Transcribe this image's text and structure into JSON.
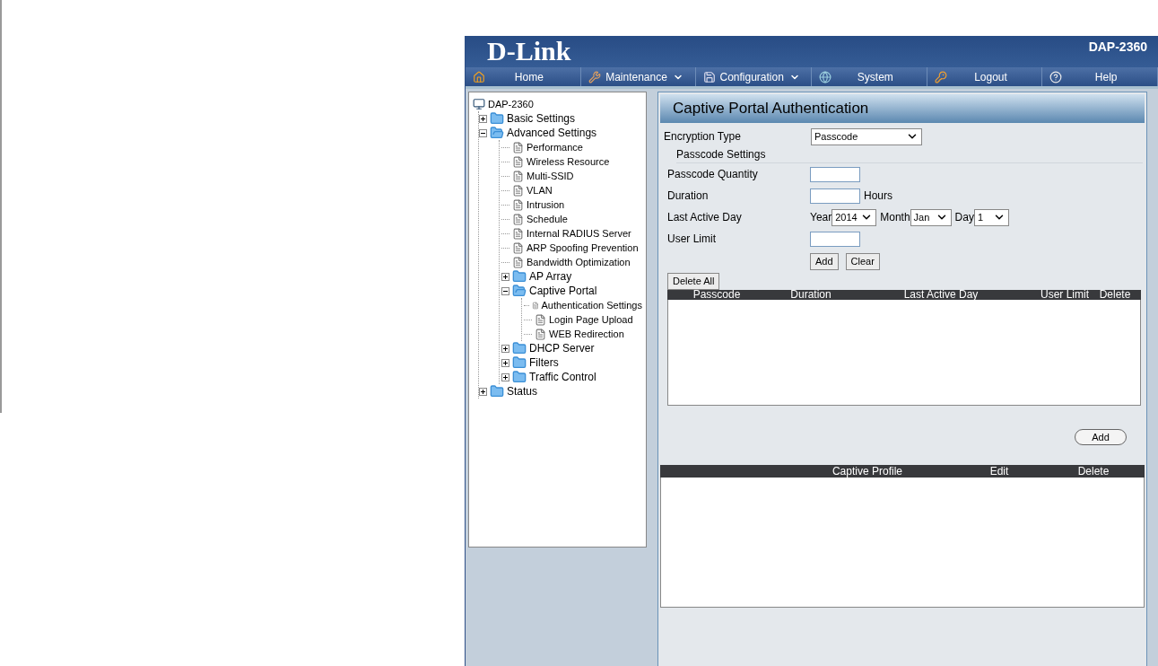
{
  "header": {
    "logo": "D-Link",
    "model": "DAP-2360"
  },
  "nav": [
    {
      "label": "Home",
      "has_menu": false
    },
    {
      "label": "Maintenance",
      "has_menu": true
    },
    {
      "label": "Configuration",
      "has_menu": true
    },
    {
      "label": "System",
      "has_menu": false
    },
    {
      "label": "Logout",
      "has_menu": false
    },
    {
      "label": "Help",
      "has_menu": false
    }
  ],
  "tree": {
    "label": "DAP-2360",
    "children": [
      {
        "label": "Basic Settings",
        "kind": "folder",
        "expanded": false
      },
      {
        "label": "Advanced Settings",
        "kind": "folder",
        "expanded": true,
        "children": [
          {
            "label": "Performance",
            "kind": "page"
          },
          {
            "label": "Wireless Resource",
            "kind": "page"
          },
          {
            "label": "Multi-SSID",
            "kind": "page"
          },
          {
            "label": "VLAN",
            "kind": "page"
          },
          {
            "label": "Intrusion",
            "kind": "page"
          },
          {
            "label": "Schedule",
            "kind": "page"
          },
          {
            "label": "Internal RADIUS Server",
            "kind": "page"
          },
          {
            "label": "ARP Spoofing Prevention",
            "kind": "page"
          },
          {
            "label": "Bandwidth Optimization",
            "kind": "page"
          },
          {
            "label": "AP Array",
            "kind": "folder",
            "expanded": false
          },
          {
            "label": "Captive Portal",
            "kind": "folder",
            "expanded": true,
            "children": [
              {
                "label": "Authentication Settings",
                "kind": "page"
              },
              {
                "label": "Login Page Upload",
                "kind": "page"
              },
              {
                "label": "WEB Redirection",
                "kind": "page"
              }
            ]
          },
          {
            "label": "DHCP Server",
            "kind": "folder",
            "expanded": false
          },
          {
            "label": "Filters",
            "kind": "folder",
            "expanded": false
          },
          {
            "label": "Traffic Control",
            "kind": "folder",
            "expanded": false
          }
        ]
      },
      {
        "label": "Status",
        "kind": "folder",
        "expanded": false
      }
    ]
  },
  "panel": {
    "title": "Captive Portal Authentication",
    "encryption_type": {
      "label": "Encryption Type",
      "value": "Passcode"
    },
    "section": "Passcode Settings",
    "passcode_quantity": {
      "label": "Passcode Quantity"
    },
    "duration": {
      "label": "Duration",
      "unit": "Hours"
    },
    "last_active_day": {
      "label": "Last Active Day",
      "year_label": "Year",
      "year": "2014",
      "month_label": "Month",
      "month": "Jan",
      "day_label": "Day",
      "day": "1"
    },
    "user_limit": {
      "label": "User Limit"
    },
    "buttons": [
      "Add",
      "Clear"
    ],
    "delete_all": "Delete All",
    "passcode_table": {
      "columns": [
        "Passcode",
        "Duration",
        "Last Active Day",
        "User Limit",
        "Delete"
      ]
    },
    "add_button": "Add",
    "profile_table": {
      "columns": [
        "Captive Profile",
        "Edit",
        "Delete"
      ]
    }
  }
}
